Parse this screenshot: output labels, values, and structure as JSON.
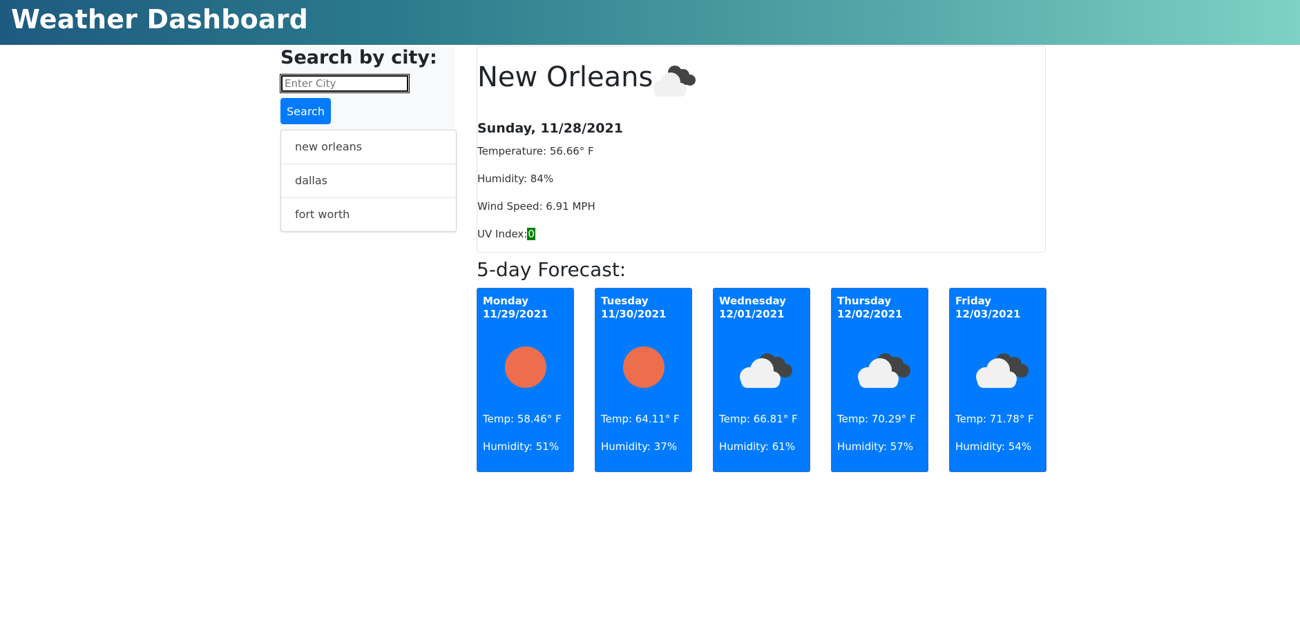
{
  "header": {
    "title": "Weather Dashboard"
  },
  "search": {
    "heading": "Search by city:",
    "placeholder": "Enter City",
    "button_label": "Search"
  },
  "history": [
    "new orleans",
    "dallas",
    "fort worth"
  ],
  "current": {
    "city": "New Orleans",
    "icon": "clouds-icon",
    "date": "Sunday, 11/28/2021",
    "temperature": "Temperature: 56.66° F",
    "humidity": "Humidity: 84%",
    "wind": "Wind Speed: 6.91 MPH",
    "uv_label": "UV Index:",
    "uv_value": "0",
    "uv_color": "#008000"
  },
  "forecast": {
    "title": "5-day Forecast:",
    "days": [
      {
        "day": "Monday",
        "date": "11/29/2021",
        "icon": "sun-icon",
        "temp": "Temp: 58.46° F",
        "humidity": "Humidity: 51%"
      },
      {
        "day": "Tuesday",
        "date": "11/30/2021",
        "icon": "sun-icon",
        "temp": "Temp: 64.11° F",
        "humidity": "Humidity: 37%"
      },
      {
        "day": "Wednesday",
        "date": "12/01/2021",
        "icon": "clouds-icon",
        "temp": "Temp: 66.81° F",
        "humidity": "Humidity: 61%"
      },
      {
        "day": "Thursday",
        "date": "12/02/2021",
        "icon": "clouds-icon",
        "temp": "Temp: 70.29° F",
        "humidity": "Humidity: 57%"
      },
      {
        "day": "Friday",
        "date": "12/03/2021",
        "icon": "clouds-icon",
        "temp": "Temp: 71.78° F",
        "humidity": "Humidity: 54%"
      }
    ]
  },
  "colors": {
    "primary": "#007bff",
    "sun": "#ec6e4c",
    "cloud_light": "#f1f1f1",
    "cloud_dark": "#444444"
  }
}
